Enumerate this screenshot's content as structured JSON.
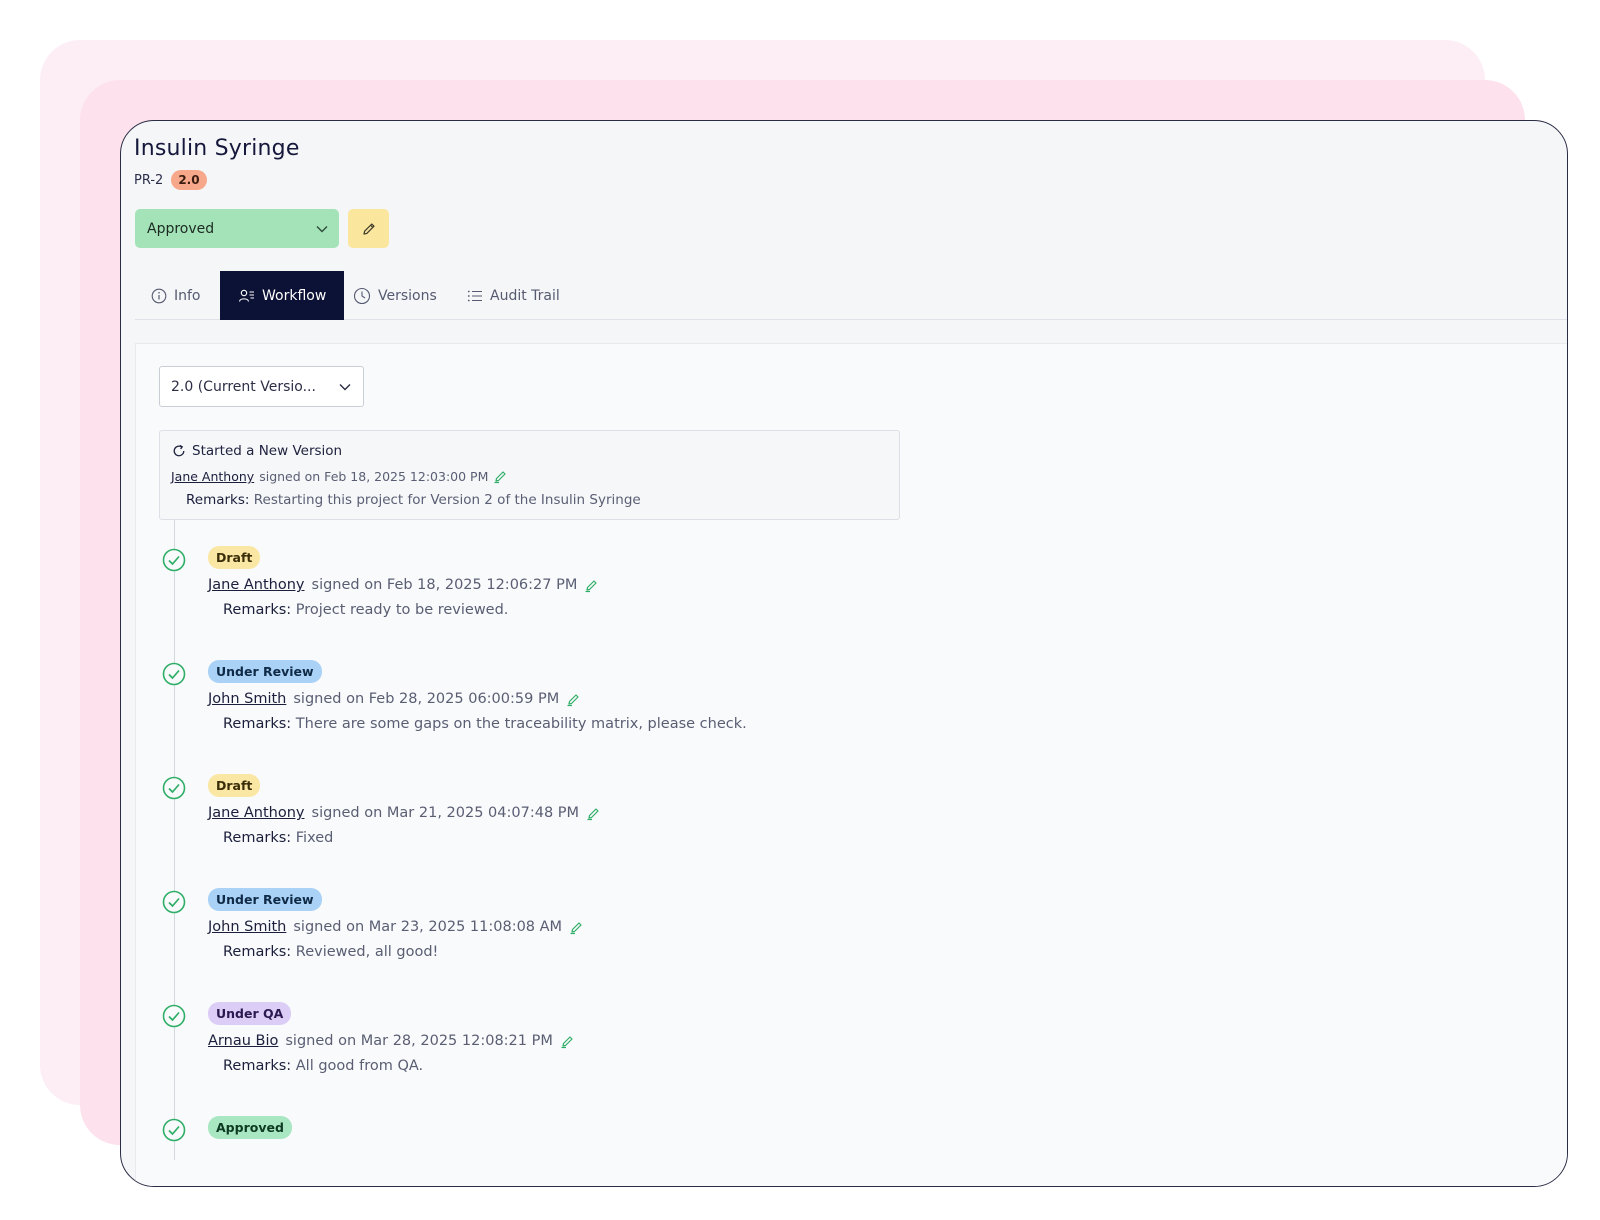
{
  "colors": {
    "accent_dark": "#0c1236",
    "approved_green": "#a4e3b8",
    "edit_yellow": "#fbe69e",
    "version_orange": "#f8a88a",
    "check_green": "#2fae67"
  },
  "header": {
    "title": "Insulin Syringe",
    "id": "PR-2",
    "version": "2.0"
  },
  "status": {
    "selected": "Approved",
    "edit_icon": "pencil-icon"
  },
  "tabs": [
    {
      "label": "Info",
      "icon": "info-icon",
      "active": false
    },
    {
      "label": "Workflow",
      "icon": "users-icon",
      "active": true
    },
    {
      "label": "Versions",
      "icon": "clock-icon",
      "active": false
    },
    {
      "label": "Audit Trail",
      "icon": "list-icon",
      "active": false
    }
  ],
  "version_select": {
    "selected": "2.0 (Current Versio..."
  },
  "start_event": {
    "title": "Started a New Version",
    "user": "Jane Anthony",
    "signed": "signed on Feb 18, 2025 12:03:00 PM",
    "remarks_label": "Remarks:",
    "remarks": "Restarting this project for Version 2 of the Insulin Syringe"
  },
  "events": [
    {
      "status": "Draft",
      "user": "Jane Anthony",
      "signed": "signed on Feb 18, 2025 12:06:27 PM",
      "remarks_label": "Remarks:",
      "remarks": "Project ready to be reviewed."
    },
    {
      "status": "Under Review",
      "user": "John Smith",
      "signed": "signed on Feb 28, 2025 06:00:59 PM",
      "remarks_label": "Remarks:",
      "remarks": "There are some gaps on the traceability matrix, please check."
    },
    {
      "status": "Draft",
      "user": "Jane Anthony",
      "signed": "signed on Mar 21, 2025 04:07:48 PM",
      "remarks_label": "Remarks:",
      "remarks": "Fixed"
    },
    {
      "status": "Under Review",
      "user": "John Smith",
      "signed": "signed on Mar 23, 2025 11:08:08 AM",
      "remarks_label": "Remarks:",
      "remarks": "Reviewed, all good!"
    },
    {
      "status": "Under QA",
      "user": "Arnau Bio",
      "signed": "signed on Mar 28, 2025 12:08:21 PM",
      "remarks_label": "Remarks:",
      "remarks": "All good from QA."
    },
    {
      "status": "Approved"
    }
  ]
}
